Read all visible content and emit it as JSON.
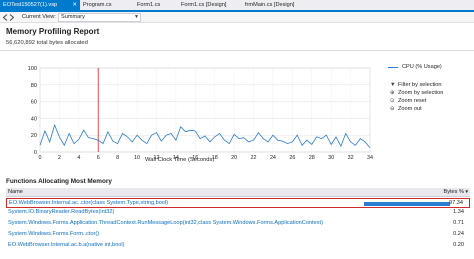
{
  "tabs": [
    {
      "label": "EOTest150527(1).vsp",
      "active": true
    },
    {
      "label": "Program.cs",
      "active": false
    },
    {
      "label": "Form1.cs",
      "active": false
    },
    {
      "label": "Form1.cs [Design]",
      "active": false
    },
    {
      "label": "frmMain.cs [Design]",
      "active": false
    }
  ],
  "toolbar": {
    "current_view_label": "Current View:",
    "current_view_value": "Summary"
  },
  "report": {
    "title": "Memory Profiling Report",
    "total_bytes": "56,620,892 total bytes allocated"
  },
  "legend": {
    "series_label": "CPU (% Usage)",
    "series_color": "#2b7cd3"
  },
  "actions": {
    "filter": "Filter by selection",
    "zoom_selection": "Zoom by selection",
    "zoom_reset": "Zoom reset",
    "zoom_out": "Zoom out"
  },
  "chart_data": {
    "type": "line",
    "xlabel": "Wall Clock Time (Seconds)",
    "ylabel": "",
    "xlim": [
      0,
      34
    ],
    "ylim": [
      0,
      100
    ],
    "x_ticks": [
      0,
      2,
      4,
      6,
      8,
      10,
      12,
      14,
      16,
      18,
      20,
      22,
      24,
      26,
      28,
      30,
      32,
      34
    ],
    "y_ticks": [
      0,
      20,
      40,
      60,
      80,
      100
    ],
    "grid": true,
    "marker_x": 6,
    "series": [
      {
        "name": "CPU (% Usage)",
        "x": [
          0,
          0.5,
          1,
          1.5,
          2,
          2.5,
          3,
          3.5,
          4,
          4.5,
          5,
          5.5,
          6,
          6.5,
          7,
          7.5,
          8,
          8.5,
          9,
          9.5,
          10,
          10.5,
          11,
          11.5,
          12,
          12.5,
          13,
          13.5,
          14,
          14.5,
          15,
          15.5,
          16,
          16.5,
          17,
          17.5,
          18,
          18.5,
          19,
          19.5,
          20,
          20.5,
          21,
          21.5,
          22,
          22.5,
          23,
          23.5,
          24,
          24.5,
          25,
          25.5,
          26,
          26.5,
          27,
          27.5,
          28,
          28.5,
          29,
          29.5,
          30,
          30.5,
          31,
          31.5,
          32,
          32.5,
          33,
          33.5,
          34
        ],
        "values": [
          8,
          25,
          12,
          32,
          18,
          8,
          22,
          10,
          15,
          26,
          17,
          16,
          14,
          10,
          24,
          13,
          10,
          22,
          18,
          12,
          20,
          14,
          10,
          20,
          23,
          13,
          20,
          22,
          14,
          30,
          24,
          26,
          25,
          16,
          19,
          12,
          18,
          22,
          14,
          10,
          21,
          16,
          17,
          12,
          14,
          23,
          16,
          12,
          20,
          14,
          13,
          10,
          12,
          20,
          8,
          14,
          9,
          18,
          16,
          20,
          9,
          18,
          7,
          22,
          12,
          8,
          16,
          12,
          5
        ]
      }
    ]
  },
  "functions": {
    "title": "Functions Allocating Most Memory",
    "col_name": "Name",
    "col_bytes": "Bytes %",
    "rows": [
      {
        "name": "EO.WebBrowser.Internal.ac..ctor(class System.Type,string,bool)",
        "bytes": "97.34",
        "highlighted": true
      },
      {
        "name": "System.IO.BinaryReader.ReadBytes(int32)",
        "bytes": "1.34",
        "highlighted": false
      },
      {
        "name": "System.Windows.Forms.Application.ThreadContext.RunMessageLoop(int32,class System.Windows.Forms.ApplicationContext)",
        "bytes": "0.71",
        "highlighted": false
      },
      {
        "name": "System.Windows.Forms.Form..ctor()",
        "bytes": "0.24",
        "highlighted": false
      },
      {
        "name": "EO.WebBrowser.Internal.ac.b.a(native int,bool)",
        "bytes": "0.20",
        "highlighted": false
      }
    ]
  }
}
